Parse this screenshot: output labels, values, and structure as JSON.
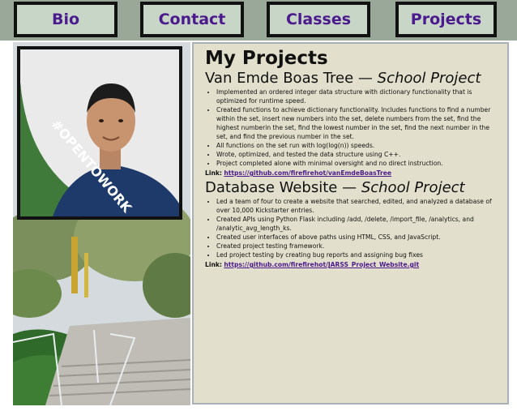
{
  "nav": {
    "tabs": [
      {
        "label": "Bio"
      },
      {
        "label": "Contact"
      },
      {
        "label": "Classes"
      },
      {
        "label": "Projects"
      }
    ]
  },
  "profile": {
    "badge_text": "#OPENTOWORK",
    "badge_color": "#3f7a3a"
  },
  "content": {
    "page_title": "My Projects",
    "projects": [
      {
        "title": "Van Emde Boas Tree",
        "dash": " — ",
        "subtitle": "School Project",
        "bullets": [
          "Implemented an ordered integer data structure with dictionary functionality that is optimized for runtime speed.",
          "Created functions to achieve dictionary functionality. Includes functions to find a number within the set, insert new numbers into the set, delete numbers from the set, find the highest numberin the set, find the lowest number in the set, find the next number in the set, and find the previous number in the set.",
          "All functions on the set run with log(log(n)) speeds.",
          "Wrote, optimized, and tested the data structure using C++.",
          "Project completed alone with minimal oversight and no direct instruction."
        ],
        "link_label": "Link:",
        "link_url": "https://github.com/firefirehot/vanEmdeBoasTree"
      },
      {
        "title": "Database Website",
        "dash": " — ",
        "subtitle": "School Project",
        "bullets": [
          "Led a team of four to create a website that searched, edited, and analyzed a database of over 10,000 Kickstarter entries.",
          "Created APIs using Python Flask including /add, /delete, /import_file, /analytics, and /analytic_avg_length_ks.",
          "Created user interfaces of above paths using HTML, CSS, and JavaScript.",
          "Created project testing framework.",
          "Led project testing by creating bug reports and assigning bug fixes"
        ],
        "link_label": "Link:",
        "link_url": "https://github.com/firefirehot/JARSS_Project_Website.git"
      }
    ]
  }
}
